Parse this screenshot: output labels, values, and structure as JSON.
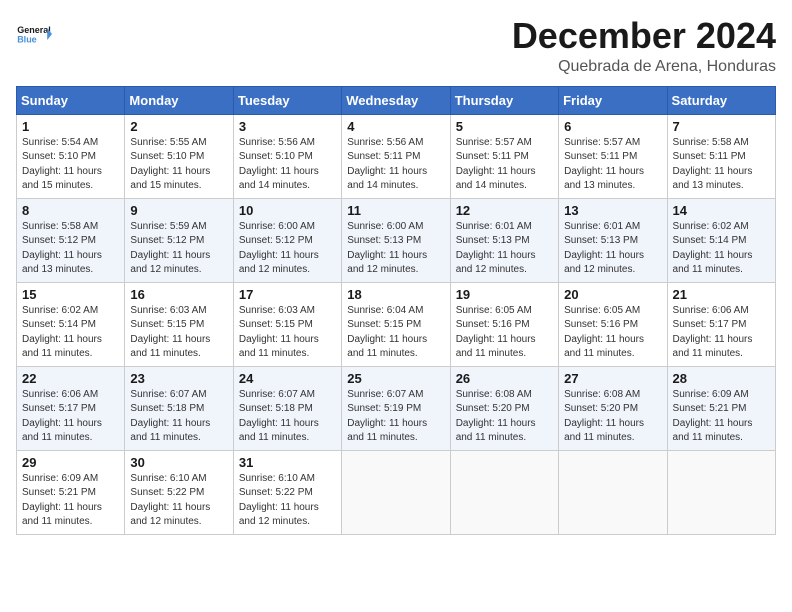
{
  "logo": {
    "line1": "General",
    "line2": "Blue"
  },
  "title": "December 2024",
  "subtitle": "Quebrada de Arena, Honduras",
  "header_row": [
    "Sunday",
    "Monday",
    "Tuesday",
    "Wednesday",
    "Thursday",
    "Friday",
    "Saturday"
  ],
  "weeks": [
    [
      {
        "day": "1",
        "info": "Sunrise: 5:54 AM\nSunset: 5:10 PM\nDaylight: 11 hours\nand 15 minutes."
      },
      {
        "day": "2",
        "info": "Sunrise: 5:55 AM\nSunset: 5:10 PM\nDaylight: 11 hours\nand 15 minutes."
      },
      {
        "day": "3",
        "info": "Sunrise: 5:56 AM\nSunset: 5:10 PM\nDaylight: 11 hours\nand 14 minutes."
      },
      {
        "day": "4",
        "info": "Sunrise: 5:56 AM\nSunset: 5:11 PM\nDaylight: 11 hours\nand 14 minutes."
      },
      {
        "day": "5",
        "info": "Sunrise: 5:57 AM\nSunset: 5:11 PM\nDaylight: 11 hours\nand 14 minutes."
      },
      {
        "day": "6",
        "info": "Sunrise: 5:57 AM\nSunset: 5:11 PM\nDaylight: 11 hours\nand 13 minutes."
      },
      {
        "day": "7",
        "info": "Sunrise: 5:58 AM\nSunset: 5:11 PM\nDaylight: 11 hours\nand 13 minutes."
      }
    ],
    [
      {
        "day": "8",
        "info": "Sunrise: 5:58 AM\nSunset: 5:12 PM\nDaylight: 11 hours\nand 13 minutes."
      },
      {
        "day": "9",
        "info": "Sunrise: 5:59 AM\nSunset: 5:12 PM\nDaylight: 11 hours\nand 12 minutes."
      },
      {
        "day": "10",
        "info": "Sunrise: 6:00 AM\nSunset: 5:12 PM\nDaylight: 11 hours\nand 12 minutes."
      },
      {
        "day": "11",
        "info": "Sunrise: 6:00 AM\nSunset: 5:13 PM\nDaylight: 11 hours\nand 12 minutes."
      },
      {
        "day": "12",
        "info": "Sunrise: 6:01 AM\nSunset: 5:13 PM\nDaylight: 11 hours\nand 12 minutes."
      },
      {
        "day": "13",
        "info": "Sunrise: 6:01 AM\nSunset: 5:13 PM\nDaylight: 11 hours\nand 12 minutes."
      },
      {
        "day": "14",
        "info": "Sunrise: 6:02 AM\nSunset: 5:14 PM\nDaylight: 11 hours\nand 11 minutes."
      }
    ],
    [
      {
        "day": "15",
        "info": "Sunrise: 6:02 AM\nSunset: 5:14 PM\nDaylight: 11 hours\nand 11 minutes."
      },
      {
        "day": "16",
        "info": "Sunrise: 6:03 AM\nSunset: 5:15 PM\nDaylight: 11 hours\nand 11 minutes."
      },
      {
        "day": "17",
        "info": "Sunrise: 6:03 AM\nSunset: 5:15 PM\nDaylight: 11 hours\nand 11 minutes."
      },
      {
        "day": "18",
        "info": "Sunrise: 6:04 AM\nSunset: 5:15 PM\nDaylight: 11 hours\nand 11 minutes."
      },
      {
        "day": "19",
        "info": "Sunrise: 6:05 AM\nSunset: 5:16 PM\nDaylight: 11 hours\nand 11 minutes."
      },
      {
        "day": "20",
        "info": "Sunrise: 6:05 AM\nSunset: 5:16 PM\nDaylight: 11 hours\nand 11 minutes."
      },
      {
        "day": "21",
        "info": "Sunrise: 6:06 AM\nSunset: 5:17 PM\nDaylight: 11 hours\nand 11 minutes."
      }
    ],
    [
      {
        "day": "22",
        "info": "Sunrise: 6:06 AM\nSunset: 5:17 PM\nDaylight: 11 hours\nand 11 minutes."
      },
      {
        "day": "23",
        "info": "Sunrise: 6:07 AM\nSunset: 5:18 PM\nDaylight: 11 hours\nand 11 minutes."
      },
      {
        "day": "24",
        "info": "Sunrise: 6:07 AM\nSunset: 5:18 PM\nDaylight: 11 hours\nand 11 minutes."
      },
      {
        "day": "25",
        "info": "Sunrise: 6:07 AM\nSunset: 5:19 PM\nDaylight: 11 hours\nand 11 minutes."
      },
      {
        "day": "26",
        "info": "Sunrise: 6:08 AM\nSunset: 5:20 PM\nDaylight: 11 hours\nand 11 minutes."
      },
      {
        "day": "27",
        "info": "Sunrise: 6:08 AM\nSunset: 5:20 PM\nDaylight: 11 hours\nand 11 minutes."
      },
      {
        "day": "28",
        "info": "Sunrise: 6:09 AM\nSunset: 5:21 PM\nDaylight: 11 hours\nand 11 minutes."
      }
    ],
    [
      {
        "day": "29",
        "info": "Sunrise: 6:09 AM\nSunset: 5:21 PM\nDaylight: 11 hours\nand 11 minutes."
      },
      {
        "day": "30",
        "info": "Sunrise: 6:10 AM\nSunset: 5:22 PM\nDaylight: 11 hours\nand 12 minutes."
      },
      {
        "day": "31",
        "info": "Sunrise: 6:10 AM\nSunset: 5:22 PM\nDaylight: 11 hours\nand 12 minutes."
      },
      {
        "day": "",
        "info": ""
      },
      {
        "day": "",
        "info": ""
      },
      {
        "day": "",
        "info": ""
      },
      {
        "day": "",
        "info": ""
      }
    ]
  ]
}
